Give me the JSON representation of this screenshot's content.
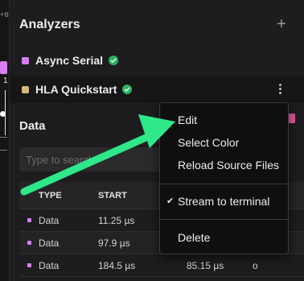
{
  "left_strip": {
    "edge_text": "+0",
    "edge_num": "1"
  },
  "analyzers": {
    "title": "Analyzers",
    "add_icon": "plus-icon",
    "items": [
      {
        "name": "Async Serial",
        "color": "#d77ff0",
        "status_icon": "check-circle-icon"
      },
      {
        "name": "HLA Quickstart",
        "color": "#d9b87a",
        "status_icon": "check-circle-icon",
        "menu_icon": "more-vertical-icon"
      }
    ]
  },
  "data": {
    "title": "Data",
    "badge_color": "#e2589b",
    "search": {
      "placeholder": "Type to search",
      "value": ""
    },
    "columns": [
      "TYPE",
      "START"
    ],
    "rows": [
      {
        "type": "Data",
        "start": "11.25 µs",
        "duration": "",
        "value": ""
      },
      {
        "type": "Data",
        "start": "97.9 µs",
        "duration": "",
        "value": ""
      },
      {
        "type": "Data",
        "start": "184.5 µs",
        "duration": "85.15 µs",
        "value": "o"
      }
    ]
  },
  "context_menu": {
    "items": [
      "Edit",
      "Select Color",
      "Reload Source Files",
      "Stream to terminal",
      "Delete"
    ],
    "checked_item": "Stream to terminal"
  },
  "overlay": {
    "arrow_color": "#2ee88a"
  }
}
